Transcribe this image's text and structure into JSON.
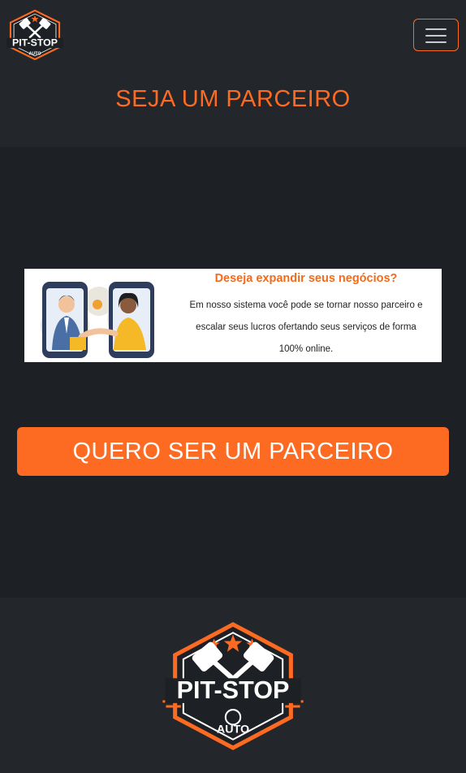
{
  "brand": {
    "logo_text": "PIT-STOP",
    "logo_subtext": "AUTO",
    "icon": "pit-stop-pistons-logo"
  },
  "navbar": {
    "toggle_icon": "hamburger-menu-icon"
  },
  "page": {
    "title": "SEJA UM PARCEIRO"
  },
  "banner": {
    "headline": "Deseja expandir seus negócios?",
    "lines": [
      "Em nosso sistema você pode se tornar nosso parceiro e",
      "escalar seus lucros ofertando seus serviços de forma",
      "100% online."
    ],
    "illustration": "partners-handshake-phones-illustration"
  },
  "cta": {
    "label": "QUERO SER UM PARCEIRO"
  },
  "colors": {
    "accent": "#fd6a21",
    "page_bg": "#23272c",
    "section_bg": "#1d2024",
    "banner_headline": "#f26a1b",
    "text_light": "#ffffff"
  }
}
